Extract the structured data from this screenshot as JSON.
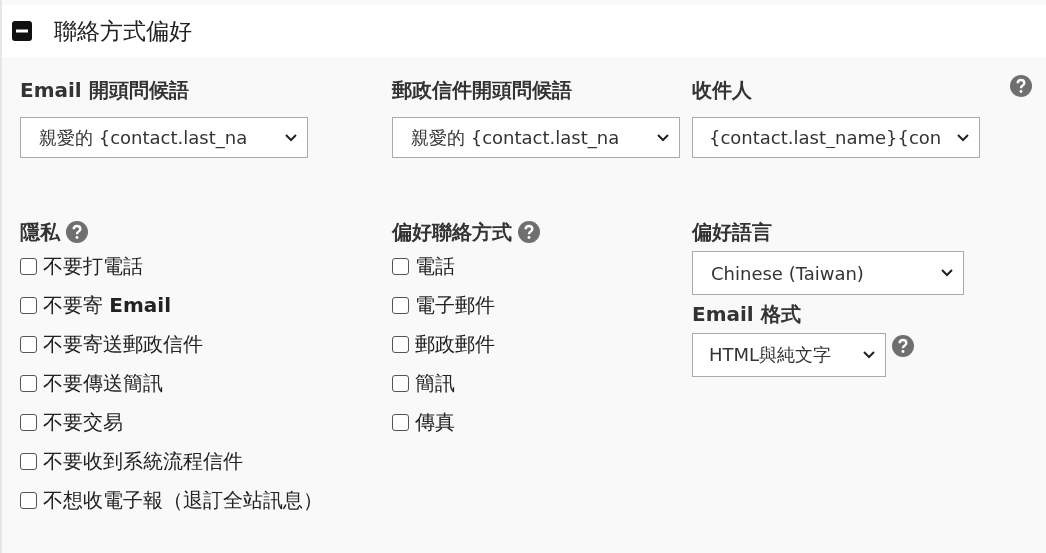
{
  "section": {
    "title": "聯絡方式偏好",
    "expanded": true
  },
  "greetings": [
    {
      "label": "Email 開頭問候語",
      "value": "親愛的 {contact.last_na"
    },
    {
      "label": "郵政信件開頭問候語",
      "value": "親愛的 {contact.last_na"
    },
    {
      "label": "收件人",
      "value": "{contact.last_name}{con"
    }
  ],
  "privacy": {
    "label": "隱私",
    "items": [
      {
        "label": "不要打電話",
        "checked": false
      },
      {
        "label": "不要寄 **Email**",
        "checked": false
      },
      {
        "label": "不要寄送郵政信件",
        "checked": false
      },
      {
        "label": "不要傳送簡訊",
        "checked": false
      },
      {
        "label": "不要交易",
        "checked": false
      },
      {
        "label": "不要收到系統流程信件",
        "checked": false
      },
      {
        "label": "不想收電子報（退訂全站訊息）",
        "checked": false
      }
    ]
  },
  "preferred_method": {
    "label": "偏好聯絡方式",
    "items": [
      {
        "label": "電話",
        "checked": false
      },
      {
        "label": "電子郵件",
        "checked": false
      },
      {
        "label": "郵政郵件",
        "checked": false
      },
      {
        "label": "簡訊",
        "checked": false
      },
      {
        "label": "傳真",
        "checked": false
      }
    ]
  },
  "language": {
    "label": "偏好語言",
    "value": "Chinese (Taiwan)"
  },
  "email_format": {
    "label": "Email 格式",
    "value": "HTML與純文字"
  }
}
